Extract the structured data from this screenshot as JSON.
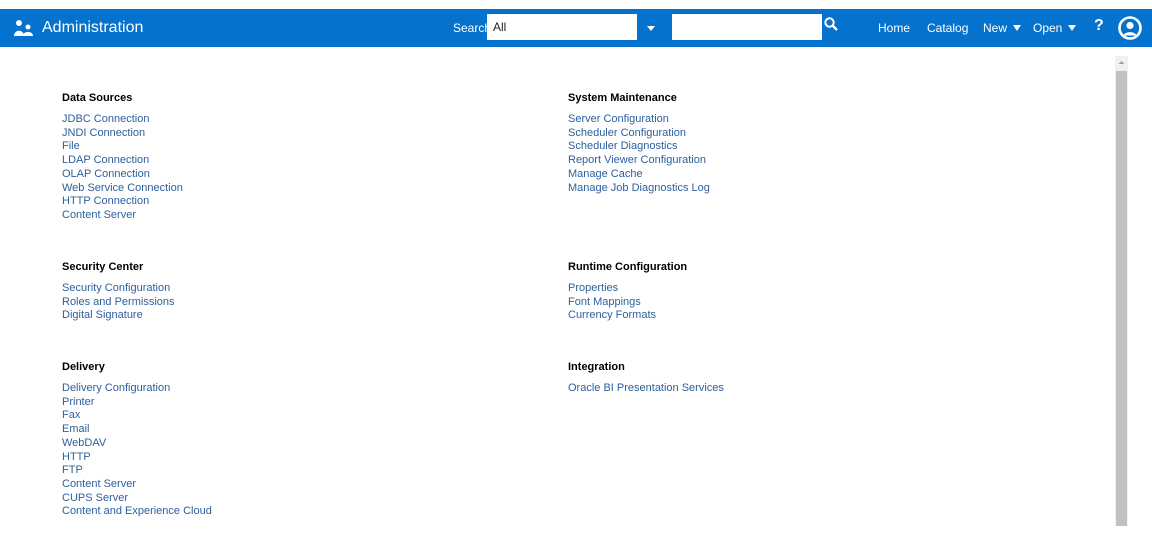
{
  "header": {
    "app_icon": "admin-people-icon",
    "title": "Administration",
    "search_label": "Search",
    "search_scope_value": "All",
    "search_input_value": "",
    "nav": {
      "home": "Home",
      "catalog": "Catalog",
      "new": "New",
      "open": "Open"
    },
    "help": "?",
    "bar_color": "#0572ce"
  },
  "link_color": "#2c5f9e",
  "sections": {
    "data_sources": {
      "title": "Data Sources",
      "links": [
        "JDBC Connection",
        "JNDI Connection",
        "File",
        "LDAP Connection",
        "OLAP Connection",
        "Web Service Connection",
        "HTTP Connection",
        "Content Server"
      ]
    },
    "system_maintenance": {
      "title": "System Maintenance",
      "links": [
        "Server Configuration",
        "Scheduler Configuration",
        "Scheduler Diagnostics",
        "Report Viewer Configuration",
        "Manage Cache",
        "Manage Job Diagnostics Log"
      ]
    },
    "security_center": {
      "title": "Security Center",
      "links": [
        "Security Configuration",
        "Roles and Permissions",
        "Digital Signature"
      ]
    },
    "runtime_configuration": {
      "title": "Runtime Configuration",
      "links": [
        "Properties",
        "Font Mappings",
        "Currency Formats"
      ]
    },
    "delivery": {
      "title": "Delivery",
      "links": [
        "Delivery Configuration",
        "Printer",
        "Fax",
        "Email",
        "WebDAV",
        "HTTP",
        "FTP",
        "Content Server",
        "CUPS Server",
        "Content and Experience Cloud"
      ]
    },
    "integration": {
      "title": "Integration",
      "links": [
        "Oracle BI Presentation Services"
      ]
    }
  }
}
